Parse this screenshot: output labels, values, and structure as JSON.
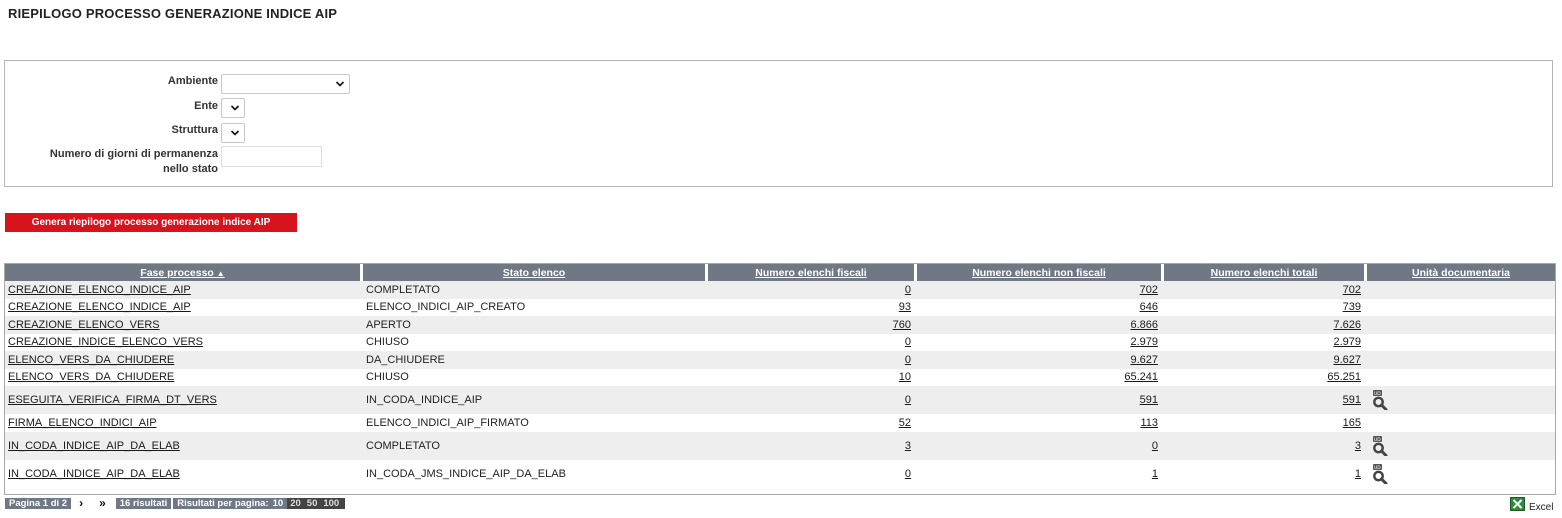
{
  "page": {
    "title": "RIEPILOGO PROCESSO GENERAZIONE INDICE AIP"
  },
  "filters": {
    "ambiente_label": "Ambiente",
    "ente_label": "Ente",
    "struttura_label": "Struttura",
    "giorni_label_line1": "Numero di giorni di permanenza",
    "giorni_label_line2": "nello stato",
    "ambiente_value": "",
    "ente_value": "",
    "struttura_value": "",
    "giorni_value": ""
  },
  "actions": {
    "generate_label": "Genera riepilogo processo generazione indice AIP"
  },
  "table": {
    "headers": {
      "fase": "Fase processo",
      "sort_indicator": "▲",
      "stato": "Stato elenco",
      "fiscali": "Numero elenchi fiscali",
      "non_fiscali": "Numero elenchi non fiscali",
      "totali": "Numero elenchi totali",
      "unita": "Unità documentaria"
    },
    "rows": [
      {
        "fase": "CREAZIONE_ELENCO_INDICE_AIP",
        "stato": "COMPLETATO",
        "fiscali": "0",
        "non_fiscali": "702",
        "totali": "702",
        "ud": false
      },
      {
        "fase": "CREAZIONE_ELENCO_INDICE_AIP",
        "stato": "ELENCO_INDICI_AIP_CREATO",
        "fiscali": "93",
        "non_fiscali": "646",
        "totali": "739",
        "ud": false
      },
      {
        "fase": "CREAZIONE_ELENCO_VERS",
        "stato": "APERTO",
        "fiscali": "760",
        "non_fiscali": "6.866",
        "totali": "7.626",
        "ud": false
      },
      {
        "fase": "CREAZIONE_INDICE_ELENCO_VERS",
        "stato": "CHIUSO",
        "fiscali": "0",
        "non_fiscali": "2.979",
        "totali": "2.979",
        "ud": false
      },
      {
        "fase": "ELENCO_VERS_DA_CHIUDERE",
        "stato": "DA_CHIUDERE",
        "fiscali": "0",
        "non_fiscali": "9.627",
        "totali": "9.627",
        "ud": false
      },
      {
        "fase": "ELENCO_VERS_DA_CHIUDERE",
        "stato": "CHIUSO",
        "fiscali": "10",
        "non_fiscali": "65.241",
        "totali": "65.251",
        "ud": false
      },
      {
        "fase": "ESEGUITA_VERIFICA_FIRMA_DT_VERS",
        "stato": "IN_CODA_INDICE_AIP",
        "fiscali": "0",
        "non_fiscali": "591",
        "totali": "591",
        "ud": true
      },
      {
        "fase": "FIRMA_ELENCO_INDICI_AIP",
        "stato": "ELENCO_INDICI_AIP_FIRMATO",
        "fiscali": "52",
        "non_fiscali": "113",
        "totali": "165",
        "ud": false
      },
      {
        "fase": "IN_CODA_INDICE_AIP_DA_ELAB",
        "stato": "COMPLETATO",
        "fiscali": "3",
        "non_fiscali": "0",
        "totali": "3",
        "ud": true
      },
      {
        "fase": "IN_CODA_INDICE_AIP_DA_ELAB",
        "stato": "IN_CODA_JMS_INDICE_AIP_DA_ELAB",
        "fiscali": "0",
        "non_fiscali": "1",
        "totali": "1",
        "ud": true
      }
    ]
  },
  "pager": {
    "page_info": "Pagina 1 di 2",
    "next": "›",
    "last": "»",
    "results": "16 risultati",
    "per_page_label": "Risultati per pagina:",
    "per_page_options": [
      "10",
      "20",
      "50",
      "100"
    ],
    "selected_per_page": "10"
  },
  "export": {
    "excel_label": "Excel"
  },
  "icons": {
    "ud_icon": "magnifier-ud-icon",
    "excel_icon": "excel-icon",
    "sort_icon": "sort-asc-icon",
    "select_icon": "chevron-down-icon"
  },
  "colors": {
    "header_bg": "#6f7884",
    "button_bg": "#d9131b",
    "row_alt_bg": "#eeeeee"
  }
}
